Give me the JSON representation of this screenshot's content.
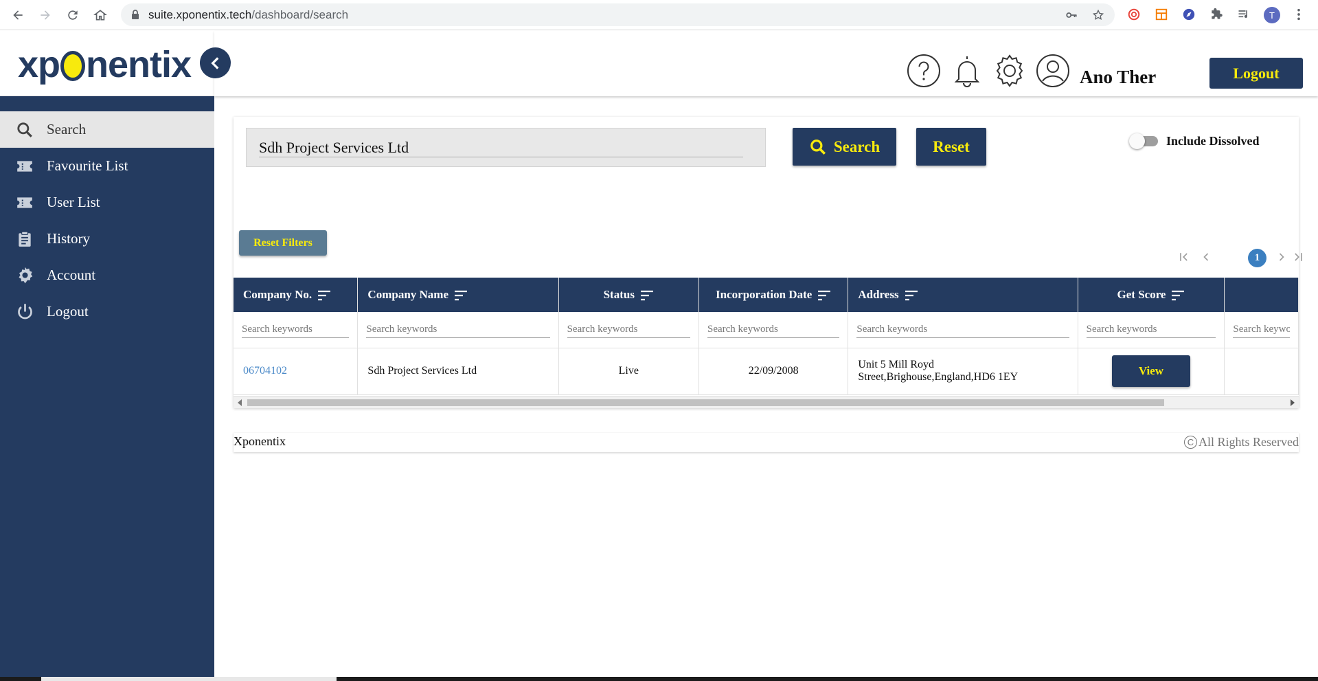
{
  "browser": {
    "url_host": "suite.xponentix.tech",
    "url_path": "/dashboard/search",
    "profile_initial": "T"
  },
  "sidebar": {
    "logo_left": "xp",
    "logo_right": "nentix",
    "items": [
      {
        "label": "Search",
        "icon": "search-icon",
        "active": true
      },
      {
        "label": "Favourite List",
        "icon": "ticket-icon"
      },
      {
        "label": "User List",
        "icon": "ticket-icon"
      },
      {
        "label": "History",
        "icon": "clipboard-icon"
      },
      {
        "label": "Account",
        "icon": "gear-icon"
      },
      {
        "label": "Logout",
        "icon": "power-icon"
      }
    ]
  },
  "header": {
    "username": "Ano Ther",
    "logout_label": "Logout"
  },
  "search": {
    "query": "Sdh Project Services Ltd",
    "search_label": "Search",
    "reset_label": "Reset",
    "include_dissolved_label": "Include Dissolved",
    "include_dissolved": false,
    "reset_filters_label": "Reset Filters"
  },
  "pager": {
    "current_page": "1"
  },
  "table": {
    "columns": [
      {
        "label": "Company No."
      },
      {
        "label": "Company Name"
      },
      {
        "label": "Status"
      },
      {
        "label": "Incorporation Date"
      },
      {
        "label": "Address"
      },
      {
        "label": "Get Score"
      }
    ],
    "filter_placeholder": "Search keywords",
    "rows": [
      {
        "company_no": "06704102",
        "company_name": "Sdh Project Services Ltd",
        "status": "Live",
        "incorporation_date": "22/09/2008",
        "address_line1": "Unit 5 Mill Royd",
        "address_line2": "Street,Brighouse,England,HD6 1EY",
        "action_label": "View"
      }
    ]
  },
  "footer": {
    "brand": "Xponentix",
    "rights": "All Rights Reserved",
    "copyright_symbol": "C"
  },
  "colors": {
    "brand_navy": "#243b60",
    "accent_yellow": "#f7ea0d",
    "link_blue": "#4a89c8",
    "reset_filters_bg": "#5a7b93"
  }
}
